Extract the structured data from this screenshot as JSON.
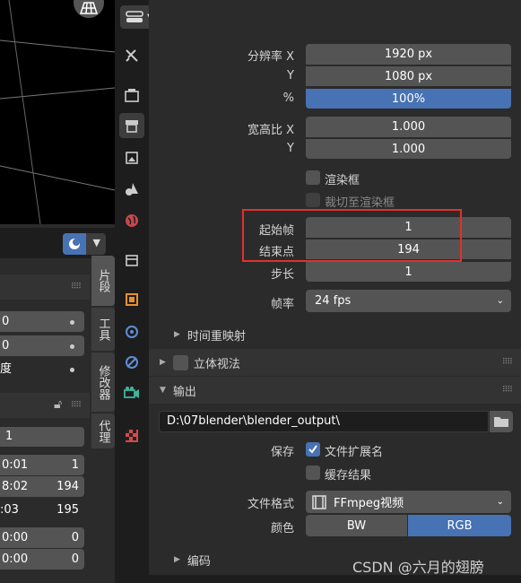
{
  "header": {
    "search_placeholder": ""
  },
  "left_panel": {
    "tabs": [
      "片段",
      "工具",
      "修改器",
      "代理"
    ],
    "rows": [
      {
        "a": "0",
        "b": ""
      },
      {
        "a": "0",
        "b": ""
      },
      {
        "a": "度",
        "b": ""
      }
    ],
    "current_frame": "1",
    "table": [
      {
        "a": "0:01",
        "b": "1"
      },
      {
        "a": "8:02",
        "b": "194"
      },
      {
        "a": ":03",
        "b": "195"
      },
      {
        "a": "0:00",
        "b": "0"
      },
      {
        "a": "0:00",
        "b": "0"
      }
    ]
  },
  "format": {
    "res_x_label": "分辨率 X",
    "res_x": "1920 px",
    "res_y_label": "Y",
    "res_y": "1080 px",
    "pct_label": "%",
    "pct": "100%",
    "aspect_x_label": "宽高比 X",
    "aspect_x": "1.000",
    "aspect_y_label": "Y",
    "aspect_y": "1.000",
    "render_region": "渲染框",
    "crop_region": "裁切至渲染框"
  },
  "frame_range": {
    "start_label": "起始帧",
    "start": "1",
    "end_label": "结束点",
    "end": "194",
    "step_label": "步长",
    "step": "1",
    "fps_label": "帧率",
    "fps": "24 fps",
    "time_remap": "时间重映射"
  },
  "stereo": {
    "label": "立体视法"
  },
  "output": {
    "label": "输出",
    "path": "D:\\07blender\\blender_output\\",
    "save_label": "保存",
    "file_ext": "文件扩展名",
    "cache_result": "缓存结果",
    "file_format_label": "文件格式",
    "file_format": "FFmpeg视频",
    "color_label": "颜色",
    "color_bw": "BW",
    "color_rgb": "RGB",
    "encoding": "编码"
  },
  "watermark": "CSDN @六月的翅膀",
  "colors": {
    "accent": "#4772b3",
    "highlight_box": "#e0302f"
  }
}
